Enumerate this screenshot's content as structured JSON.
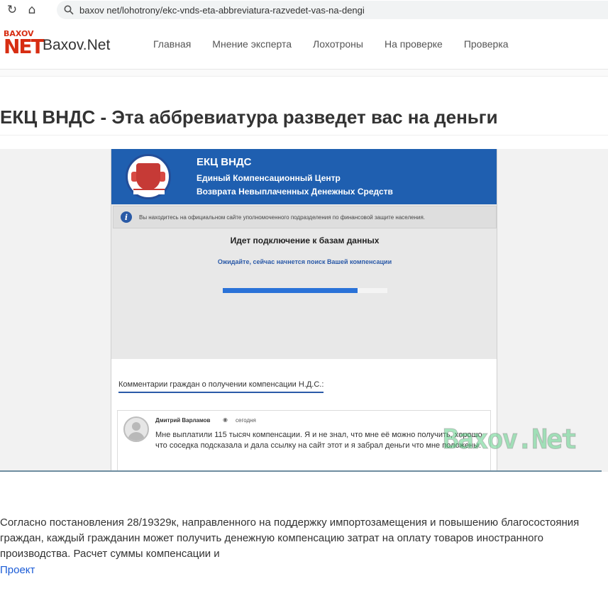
{
  "browser": {
    "url": "baxov net/lohotrony/ekc-vnds-eta-abbreviatura-razvedet-vas-na-dengi",
    "icons": [
      "refresh-icon",
      "home-icon",
      "search-icon"
    ]
  },
  "header": {
    "logo_top": "BAXOV",
    "logo_bottom": "NET",
    "site_name": "Baxov.Net",
    "menu": [
      "Главная",
      "Мнение эксперта",
      "Лохотроны",
      "На проверке",
      "Проверка"
    ]
  },
  "article": {
    "title": "ЕКЦ ВНДС - Эта аббревиатура разведет вас на деньги",
    "body": "Согласно постановления 28/19329к, направленного на поддержку импортозамещения и повышению благосостояния граждан, каждый гражданин может получить денежную компенсацию затрат на оплату товаров иностранного производства. Расчет суммы компенсации и",
    "link": "Проект"
  },
  "screenshot": {
    "banner_title": "ЕКЦ ВНДС",
    "banner_sub1": "Единый Компенсационный Центр",
    "banner_sub2": "Возврата Невыплаченных Денежных Средств",
    "info_text": "Вы находитесь на официальном сайте уполномоченного подразделения по финансовой защите населения.",
    "connecting_title": "Идет подключение к базам данных",
    "connecting_sub": "Ожидайте, сейчас начнется поиск Вашей компенсации",
    "progress": 0.82,
    "comments_heading": "Комментарии граждан о получении компенсации Н.Д.С.:",
    "comment": {
      "author": "Дмитрий Варламов",
      "time": "сегодня",
      "text": "Мне выплатили 115 тысяч компенсации. Я и не знал, что мне её можно получить, хорошо что соседка подсказала и дала ссылку на сайт этот и я забрал деньги что мне положены."
    },
    "watermark": "Baxov.Net"
  },
  "colors": {
    "banner_blue": "#1f5fb0",
    "progress_blue": "#2a72d8",
    "logo_red": "#d72d12",
    "link_blue": "#1a5bd6"
  }
}
